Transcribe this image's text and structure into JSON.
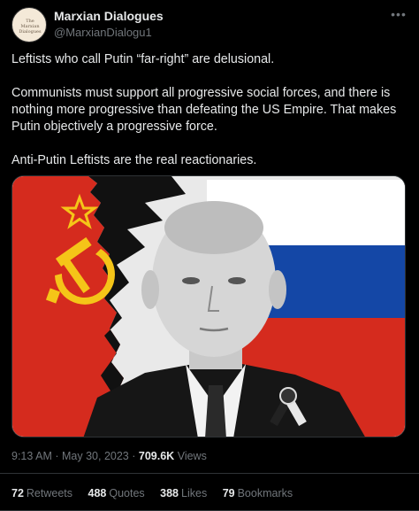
{
  "author": {
    "display_name": "Marxian Dialogues",
    "handle": "@MarxianDialogu1",
    "avatar_text": "The Marxian Dialogues"
  },
  "tweet": {
    "paragraphs": [
      "Leftists who call Putin “far-right” are delusional.",
      "Communists must support all progressive social forces, and there is nothing more progressive than defeating the US Empire. That makes Putin objectively a progressive force.",
      "Anti-Putin Leftists are the real reactionaries."
    ]
  },
  "media": {
    "description_icons": [
      "hammer-sickle-icon",
      "star-icon",
      "russian-flag",
      "soviet-flag"
    ],
    "colors": {
      "soviet_red": "#d52b1e",
      "emblem_gold": "#f5c518",
      "flag_white": "#ffffff",
      "flag_blue": "#1447a6",
      "flag_red": "#d52b1e"
    }
  },
  "meta": {
    "time": "9:13 AM",
    "separator": "·",
    "date": "May 30, 2023",
    "views_count": "709.6K",
    "views_label": "Views"
  },
  "stats": {
    "retweets_count": "72",
    "retweets_label": "Retweets",
    "quotes_count": "488",
    "quotes_label": "Quotes",
    "likes_count": "388",
    "likes_label": "Likes",
    "bookmarks_count": "79",
    "bookmarks_label": "Bookmarks"
  },
  "colors": {
    "background": "#000000",
    "text_primary": "#e7e9ea",
    "text_secondary": "#71767b",
    "divider": "#2f3336"
  }
}
